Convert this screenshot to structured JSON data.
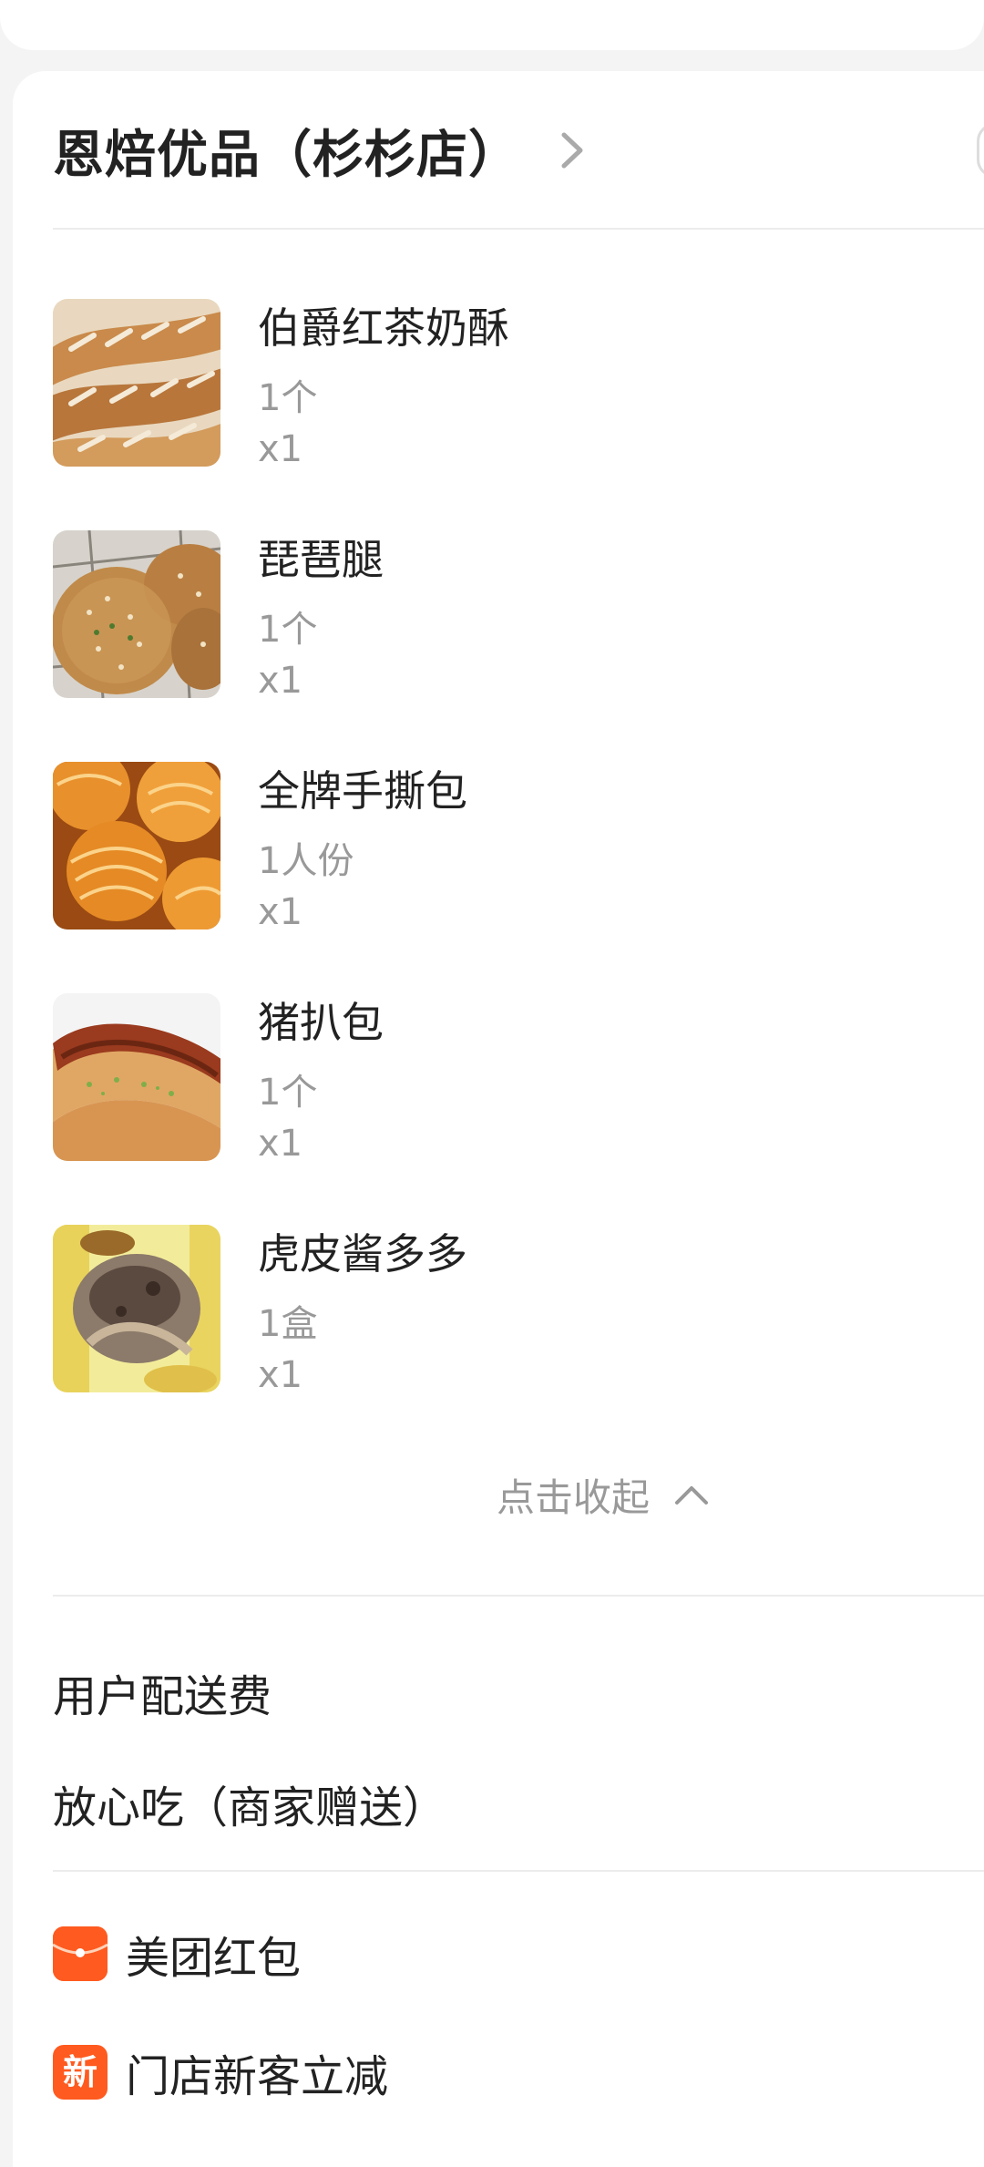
{
  "store": {
    "name": "恩焙优品（杉杉店）"
  },
  "items": [
    {
      "name": "伯爵红茶奶酥",
      "spec": "1个",
      "qty": "x1",
      "image": "earl-grey-pastry-photo"
    },
    {
      "name": "琵琶腿",
      "spec": "1个",
      "qty": "x1",
      "image": "drumstick-bun-photo"
    },
    {
      "name": "全牌手撕包",
      "spec": "1人份",
      "qty": "x1",
      "image": "pull-apart-bread-photo"
    },
    {
      "name": "猪扒包",
      "spec": "1个",
      "qty": "x1",
      "image": "pork-chop-bun-photo"
    },
    {
      "name": "虎皮酱多多",
      "spec": "1盒",
      "qty": "x1",
      "image": "tiger-skin-roll-photo"
    }
  ],
  "collapse": {
    "label": "点击收起",
    "icon": "chevron-up-icon"
  },
  "fees": {
    "delivery": "用户配送费",
    "assurance": "放心吃（商家赠送）"
  },
  "promotions": [
    {
      "icon": "red-envelope-icon",
      "icon_text": "",
      "label": "美团红包"
    },
    {
      "icon": "new-badge-icon",
      "icon_text": "新",
      "label": "门店新客立减"
    }
  ],
  "colors": {
    "accent": "#ff5a1f",
    "text_primary": "#222222",
    "text_secondary": "#999999"
  }
}
